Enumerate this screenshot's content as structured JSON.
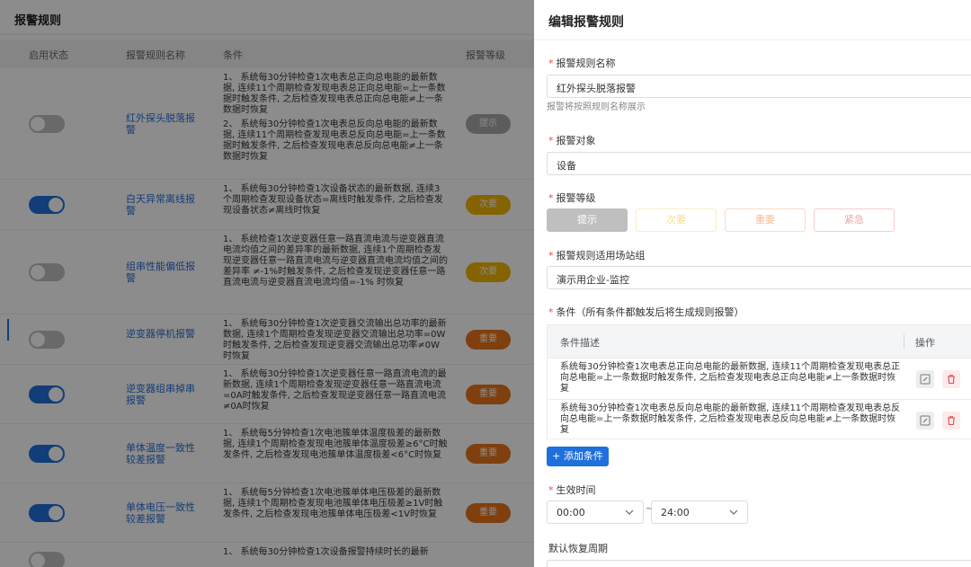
{
  "left": {
    "title": "报警规则",
    "columns": [
      "启用状态",
      "报警规则名称",
      "条件",
      "报警等级"
    ],
    "rows": [
      {
        "enabled": false,
        "name": "红外探头脱落报警",
        "conditions": [
          "1、 系统每30分钟检查1次电表总正向总电能的最新数据, 连续11个周期检查发现电表总正向总电能=上一条数据时触发条件, 之后检查发现电表总正向总电能≠上一条数据时恢复",
          "2、 系统每30分钟检查1次电表总反向总电能的最新数据, 连续11个周期检查发现电表总反向总电能=上一条数据时触发条件, 之后检查发现电表总反向总电能≠上一条数据时恢复"
        ],
        "level": "提示"
      },
      {
        "enabled": true,
        "name": "白天异常离线报警",
        "conditions": [
          "1、 系统每30分钟检查1次设备状态的最新数据, 连续3个周期检查发现设备状态=离线时触发条件, 之后检查发现设备状态≠离线时恢复"
        ],
        "level": "次要"
      },
      {
        "enabled": false,
        "name": "组串性能偏低报警",
        "conditions": [
          "1、 系统检查1次逆变器任意一路直流电流与逆变器直流电流均值之间的差异率的最新数据, 连续1个周期检查发现逆变器任意一路直流电流与逆变器直流电流均值之间的差异率 ≠-1%时触发条件, 之后检查发现逆变器任意一路直流电流与逆变器直流电流均值=-1% 时恢复"
        ],
        "level": "次要"
      },
      {
        "enabled": false,
        "name": "逆变器停机报警",
        "conditions": [
          "1、 系统每30分钟检查1次逆变器交流输出总功率的最新数据, 连续1个周期检查发现逆变器交流输出总功率=0W时触发条件, 之后检查发现逆变器交流输出总功率≠0W时恢复"
        ],
        "level": "重要"
      },
      {
        "enabled": true,
        "name": "逆变器组串掉串报警",
        "conditions": [
          "1、 系统每30分钟检查1次逆变器任意一路直流电流的最新数据, 连续1个周期检查发现逆变器任意一路直流电流=0A时触发条件, 之后检查发现逆变器任意一路直流电流≠0A时恢复"
        ],
        "level": "重要"
      },
      {
        "enabled": true,
        "name": "单体温度一致性较差报警",
        "conditions": [
          "1、 系统每5分钟检查1次电池簇单体温度极差的最新数据, 连续1个周期检查发现电池簇单体温度极差≥6°C时触发条件, 之后检查发现电池簇单体温度极差<6°C时恢复"
        ],
        "level": "重要"
      },
      {
        "enabled": true,
        "name": "单体电压一致性较差报警",
        "conditions": [
          "1、 系统每5分钟检查1次电池簇单体电压极差的最新数据, 连续1个周期检查发现电池簇单体电压极差≥1V时触发条件, 之后检查发现电池簇单体电压极差<1V时恢复"
        ],
        "level": "重要"
      },
      {
        "enabled": false,
        "name": "",
        "conditions": [
          "1、 系统每30分钟检查1次设备报警持续时长的最新"
        ],
        "level": ""
      }
    ]
  },
  "panel": {
    "title": "编辑报警规则",
    "name_label": "报警规则名称",
    "name_value": "红外探头脱落报警",
    "name_hint": "报警将按照规则名称展示",
    "target_label": "报警对象",
    "target_value": "设备",
    "level_label": "报警等级",
    "levels": [
      "提示",
      "次要",
      "重要",
      "紧急"
    ],
    "group_label": "报警规则适用场站组",
    "group_value": "演示用企业-监控",
    "cond_label": "条件（所有条件都触发后将生成规则报警）",
    "cond_col_desc": "条件描述",
    "cond_col_ops": "操作",
    "conditions": [
      "系统每30分钟检查1次电表总正向总电能的最新数据, 连续11个周期检查发现电表总正向总电能=上一条数据时触发条件, 之后检查发现电表总正向总电能≠上一条数据时恢复",
      "系统每30分钟检查1次电表总反向总电能的最新数据, 连续11个周期检查发现电表总反向总电能=上一条数据时触发条件, 之后检查发现电表总反向总电能≠上一条数据时恢复"
    ],
    "add_condition": "+ 添加条件",
    "effective_label": "生效时间",
    "time_start": "00:00",
    "time_sep": "~",
    "time_end": "24:00",
    "recovery_label": "默认恢复周期"
  },
  "colors": {
    "primary": "#1f6fdc",
    "level_hint": "#a8a8a8",
    "level_minor": "#f0b400",
    "level_major": "#e8741a",
    "danger": "#e34d4d"
  }
}
